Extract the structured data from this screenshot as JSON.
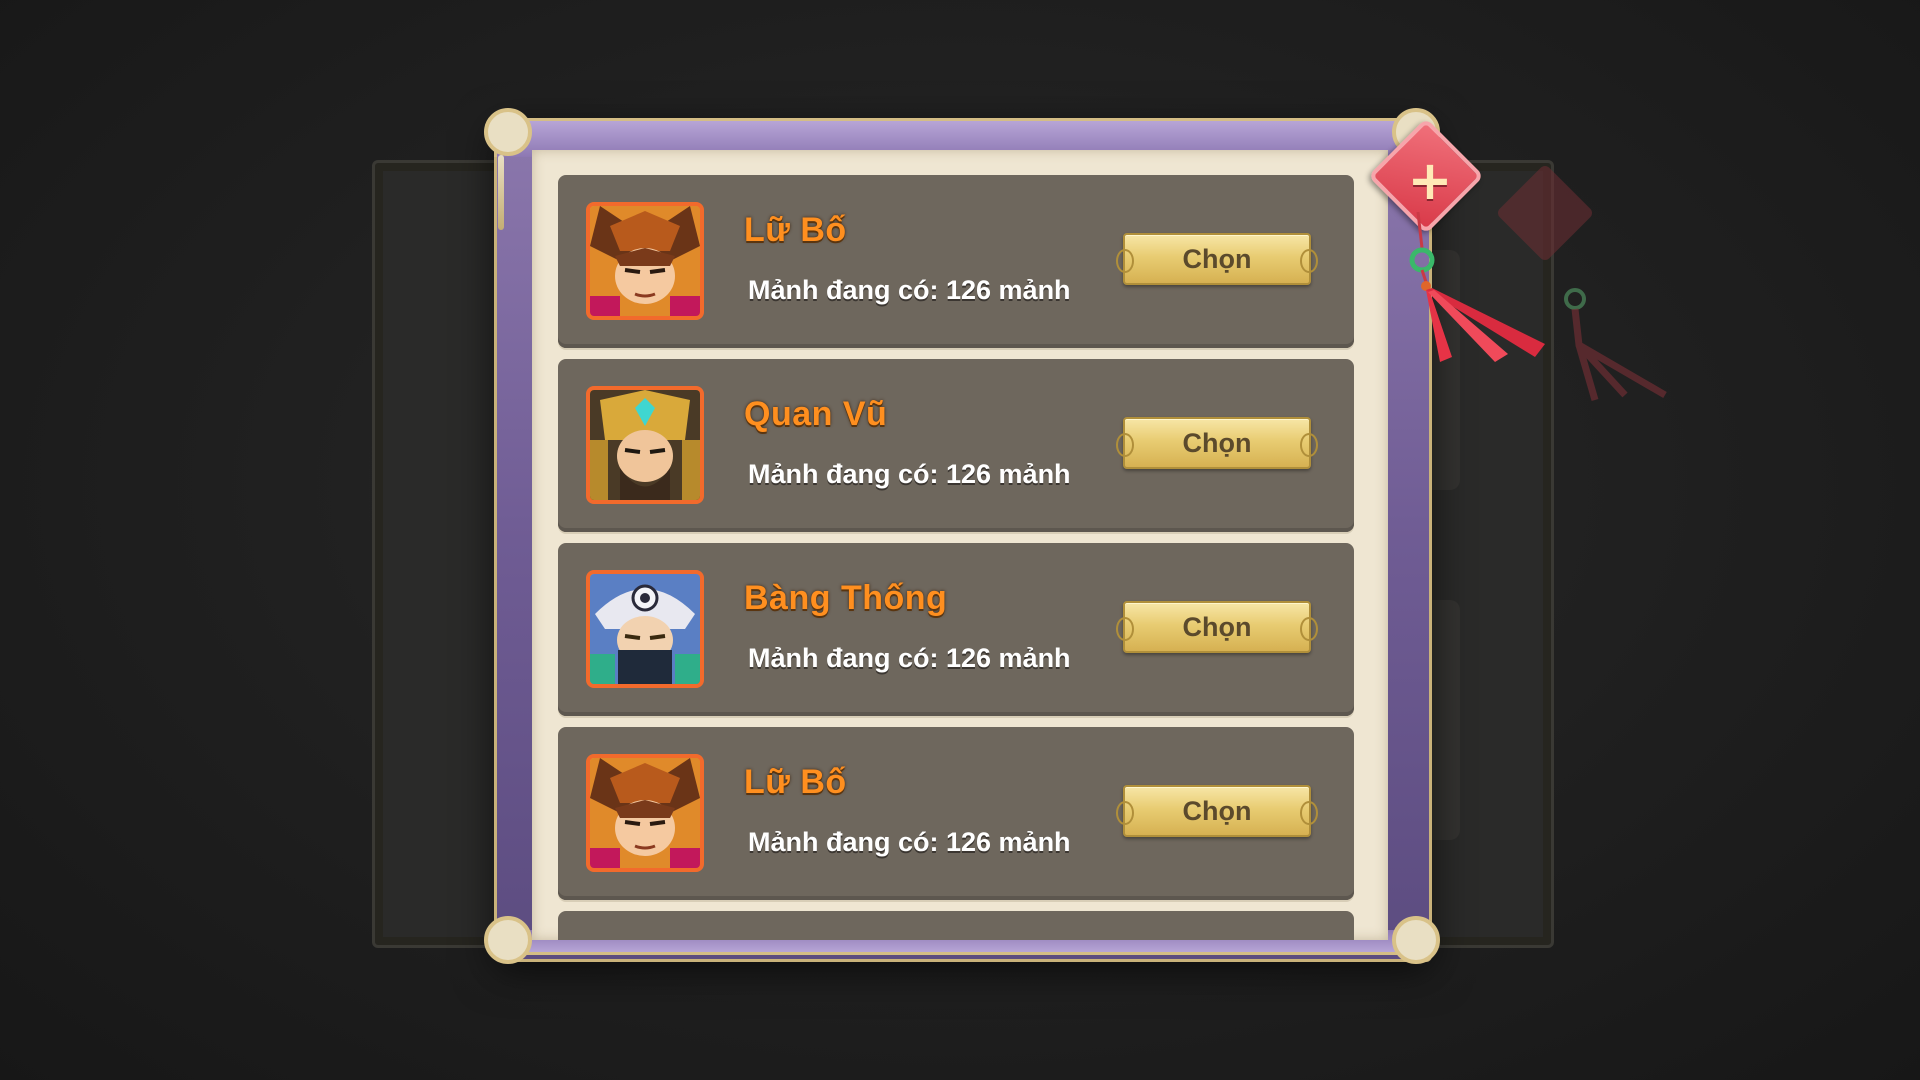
{
  "dialog": {
    "close_icon": "close-icon",
    "accent_color": "#ff8f1f",
    "heroes": [
      {
        "name": "Lữ Bố",
        "stock_label": "Mảnh đang có: 126 mảnh",
        "button_label": "Chọn",
        "portrait": "lu-bo-portrait"
      },
      {
        "name": "Quan Vũ",
        "stock_label": "Mảnh đang có: 126 mảnh",
        "button_label": "Chọn",
        "portrait": "quan-vu-portrait"
      },
      {
        "name": "Bàng Thống",
        "stock_label": "Mảnh đang có: 126 mảnh",
        "button_label": "Chọn",
        "portrait": "bang-thong-portrait"
      },
      {
        "name": "Lữ Bố",
        "stock_label": "Mảnh đang có: 126 mảnh",
        "button_label": "Chọn",
        "portrait": "lu-bo-portrait"
      }
    ]
  }
}
